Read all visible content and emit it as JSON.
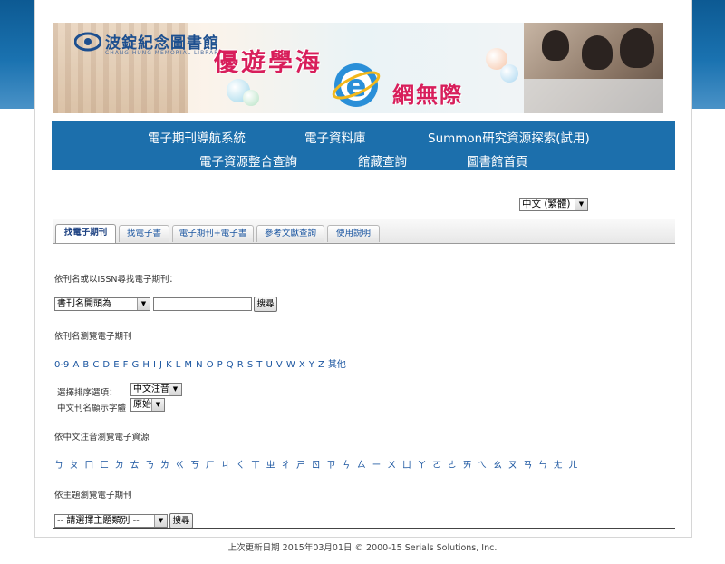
{
  "banner": {
    "logo_text": "波錠紀念圖書館",
    "logo_sub": "CHANG HUNG MEMORIAL LIBRARY",
    "slogan_line1": "優遊學海",
    "slogan_line2": "網無際",
    "ie_letter": "e"
  },
  "nav": {
    "items": [
      "電子期刊導航系統",
      "電子資料庫",
      "Summon研究資源探索(試用)",
      "電子資源整合查詢",
      "館藏查詢",
      "圖書館首頁"
    ]
  },
  "language": {
    "selected": "中文 (繁體)"
  },
  "tabs": [
    {
      "label": "找電子期刊",
      "active": true
    },
    {
      "label": "找電子書"
    },
    {
      "label": "電子期刊+電子書"
    },
    {
      "label": "參考文獻查詢"
    },
    {
      "label": "使用說明"
    }
  ],
  "search": {
    "section_label": "依刊名或以ISSN尋找電子期刊：",
    "mode_selected": "書刊名開頭為",
    "query_value": "",
    "button": "搜尋"
  },
  "browse_title": {
    "section_label": "依刊名瀏覽電子期刊",
    "letters": [
      "0-9",
      "A",
      "B",
      "C",
      "D",
      "E",
      "F",
      "G",
      "H",
      "I",
      "J",
      "K",
      "L",
      "M",
      "N",
      "O",
      "P",
      "Q",
      "R",
      "S",
      "T",
      "U",
      "V",
      "W",
      "X",
      "Y",
      "Z",
      "其他"
    ]
  },
  "options": {
    "sort_label": "選擇排序選項：",
    "sort_selected": "中文注音",
    "font_label": "中文刊名顯示字體",
    "font_selected": "原始"
  },
  "zhuyin_browse": {
    "section_label": "依中文注音瀏覽電子資源",
    "symbols": [
      "ㄅ",
      "ㄆ",
      "ㄇ",
      "ㄈ",
      "ㄉ",
      "ㄊ",
      "ㄋ",
      "ㄌ",
      "ㄍ",
      "ㄎ",
      "ㄏ",
      "ㄐ",
      "ㄑ",
      "ㄒ",
      "ㄓ",
      "ㄔ",
      "ㄕ",
      "ㄖ",
      "ㄗ",
      "ㄘ",
      "ㄙ",
      "ㄧ",
      "ㄨ",
      "ㄩ",
      "ㄚ",
      "ㄛ",
      "ㄜ",
      "ㄞ",
      "ㄟ",
      "ㄠ",
      "ㄡ",
      "ㄢ",
      "ㄣ",
      "ㄤ",
      "ㄦ"
    ]
  },
  "subject_browse": {
    "section_label": "依主題瀏覽電子期刊",
    "selected": "-- 請選擇主題類別 --",
    "button": "搜尋"
  },
  "footer": {
    "text": "上次更新日期 2015年03月01日 © 2000-15 Serials Solutions, Inc."
  },
  "colors": {
    "nav_bg": "#1c6fac",
    "link": "#1a55a0",
    "slogan": "#d81e5b"
  }
}
